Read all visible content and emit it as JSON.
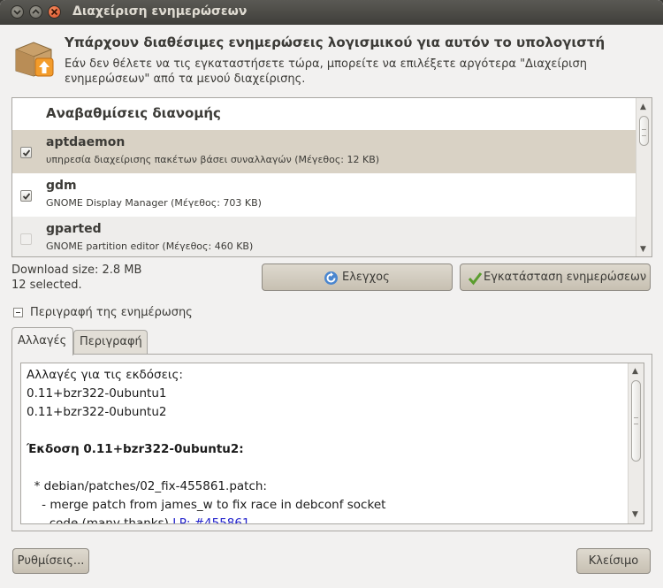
{
  "window": {
    "title": "Διαχείριση ενημερώσεων",
    "controls": [
      "minimize-icon",
      "maximize-icon",
      "close-icon"
    ]
  },
  "header": {
    "icon": "package-update-icon",
    "headline": "Υπάρχουν διαθέσιμες ενημερώσεις λογισμικού για αυτόν το υπολογιστή",
    "subtext": "Εάν δεν θέλετε να τις εγκαταστήσετε τώρα, μπορείτε να επιλέξετε αργότερα \"Διαχείριση ενημερώσεων\" από τα μενού διαχείρισης."
  },
  "updates": {
    "group_title": "Αναβαθμίσεις διανομής",
    "items": [
      {
        "name": "aptdaemon",
        "description": "υπηρεσία διαχείρισης πακέτων βάσει συναλλαγών (Μέγεθος: 12 KB)",
        "checked": true,
        "selected": true
      },
      {
        "name": "gdm",
        "description": "GNOME Display Manager (Μέγεθος: 703 KB)",
        "checked": true,
        "selected": false
      },
      {
        "name": "gparted",
        "description": "GNOME partition editor (Μέγεθος: 460 KB)",
        "checked": false,
        "selected": false
      }
    ]
  },
  "summary": {
    "download_size": "Download size: 2.8 MB",
    "selected_count": "12 selected."
  },
  "actions": {
    "check_label": "Ελεγχος",
    "check_icon": "refresh-icon",
    "install_label": "Εγκατάσταση ενημερώσεων",
    "install_icon": "checkmark-icon"
  },
  "details": {
    "expander_label": "Περιγραφή της ενημέρωσης",
    "tabs": [
      {
        "label": "Αλλαγές",
        "active": true
      },
      {
        "label": "Περιγραφή",
        "active": false
      }
    ],
    "changelog": {
      "line1": "Αλλαγές για τις εκδόσεις:",
      "line2": "0.11+bzr322-0ubuntu1",
      "line3": "0.11+bzr322-0ubuntu2",
      "heading": "Έκδοση 0.11+bzr322-0ubuntu2:",
      "line5": "  * debian/patches/02_fix-455861.patch:",
      "line6": "    - merge patch from james_w to fix race in debconf socket",
      "line7_prefix": "      code (many thanks) ",
      "line7_link": "LP: #455861"
    }
  },
  "footer": {
    "settings_label": "Ρυθμίσεις...",
    "close_label": "Κλείσιμο"
  },
  "colors": {
    "titlebar": "#3f3e3a",
    "selected_row": "#d9d2c5",
    "link": "#2222cc"
  }
}
